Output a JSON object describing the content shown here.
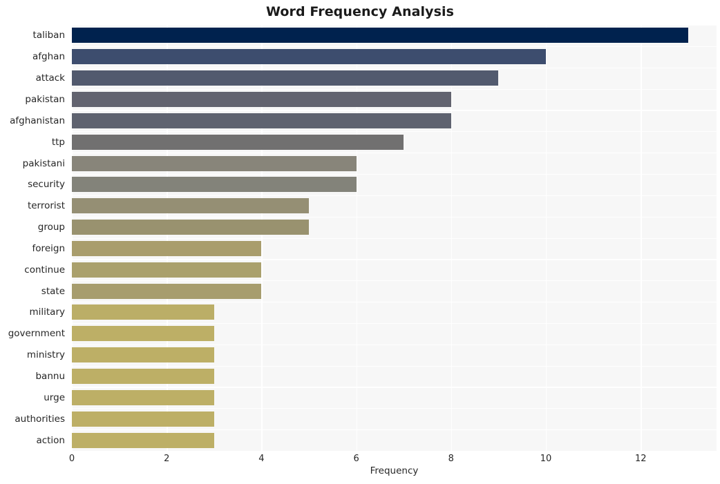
{
  "chart_data": {
    "type": "bar",
    "orientation": "horizontal",
    "title": "Word Frequency Analysis",
    "xlabel": "Frequency",
    "ylabel": "",
    "categories": [
      "taliban",
      "afghan",
      "attack",
      "pakistan",
      "afghanistan",
      "ttp",
      "pakistani",
      "security",
      "terrorist",
      "group",
      "foreign",
      "continue",
      "state",
      "military",
      "government",
      "ministry",
      "bannu",
      "urge",
      "authorities",
      "action"
    ],
    "values": [
      13,
      10,
      9,
      8,
      8,
      7,
      6,
      6,
      5,
      5,
      4,
      4,
      4,
      3,
      3,
      3,
      3,
      3,
      3,
      3
    ],
    "xlim": [
      0,
      13.6
    ],
    "xticks": [
      0,
      2,
      4,
      6,
      8,
      10,
      12
    ],
    "xtick_labels": [
      "0",
      "2",
      "4",
      "6",
      "8",
      "10",
      "12"
    ],
    "grid": true,
    "grid_color": "#ffffff",
    "plot_background": "#f7f7f7",
    "figure_background": "#ffffff",
    "colormap": "cividis",
    "legend": null,
    "bar_colors": [
      "#00224e",
      "#3d4d6e",
      "#525a6e",
      "#62636f",
      "#5f6370",
      "#717070",
      "#88857a",
      "#83837a",
      "#958f74",
      "#99926f",
      "#a99d6c",
      "#aaa06c",
      "#a79d6e",
      "#bbae67",
      "#bdaf66",
      "#bdaf66",
      "#bdaf66",
      "#bdaf66",
      "#bdaf66",
      "#bdaf66"
    ]
  }
}
